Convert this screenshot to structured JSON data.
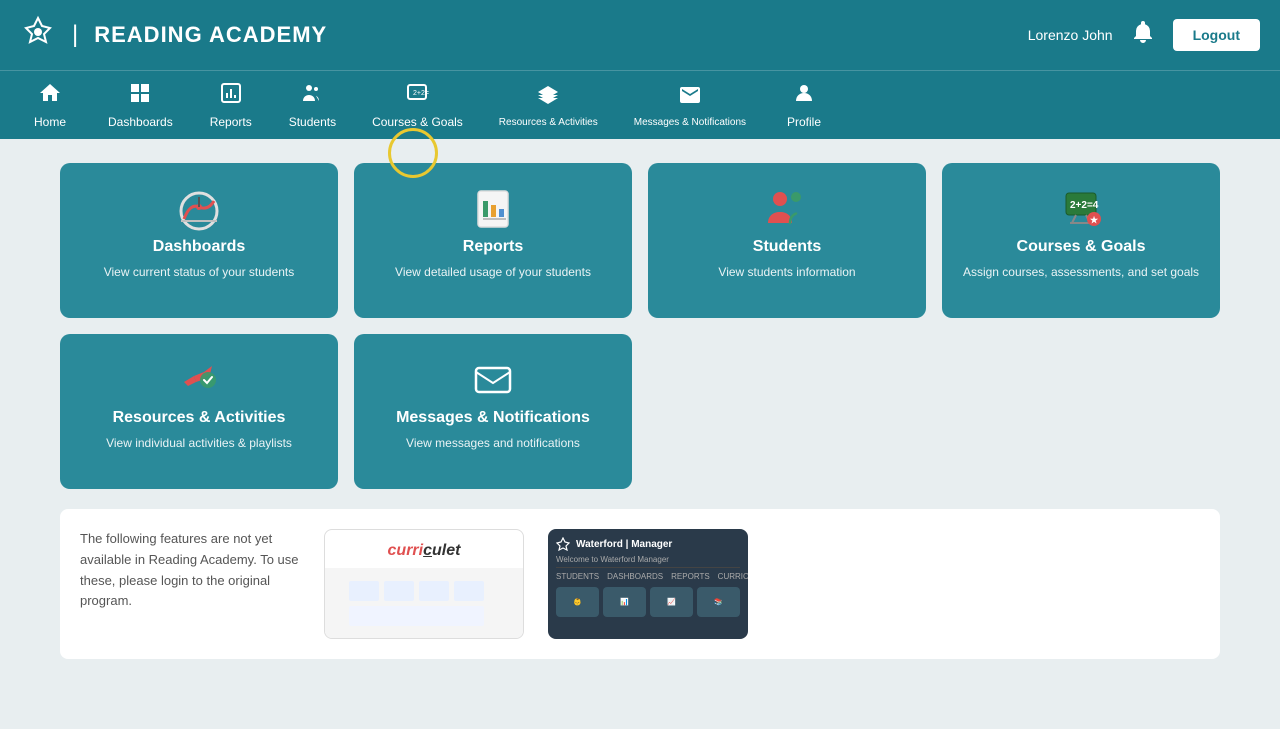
{
  "header": {
    "logo_text": "READING ACADEMY",
    "user_name": "Lorenzo John",
    "logout_label": "Logout"
  },
  "nav": {
    "items": [
      {
        "id": "home",
        "label": "Home",
        "icon": "home"
      },
      {
        "id": "dashboards",
        "label": "Dashboards",
        "icon": "dashboard"
      },
      {
        "id": "reports",
        "label": "Reports",
        "icon": "reports"
      },
      {
        "id": "students",
        "label": "Students",
        "icon": "students"
      },
      {
        "id": "courses",
        "label": "Courses & Goals",
        "icon": "courses"
      },
      {
        "id": "resources",
        "label": "Resources & Activities",
        "icon": "resources"
      },
      {
        "id": "messages",
        "label": "Messages & Notifications",
        "icon": "messages"
      },
      {
        "id": "profile",
        "label": "Profile",
        "icon": "profile"
      }
    ]
  },
  "cards": {
    "row1": [
      {
        "id": "dashboards",
        "title": "Dashboards",
        "desc": "View current status of your students"
      },
      {
        "id": "reports",
        "title": "Reports",
        "desc": "View detailed usage of your students"
      },
      {
        "id": "students",
        "title": "Students",
        "desc": "View students information"
      },
      {
        "id": "courses",
        "title": "Courses & Goals",
        "desc": "Assign courses, assessments, and set goals"
      }
    ],
    "row2": [
      {
        "id": "resources",
        "title": "Resources & Activities",
        "desc": "View individual activities & playlists"
      },
      {
        "id": "messages",
        "title": "Messages & Notifications",
        "desc": "View messages and notifications"
      }
    ]
  },
  "bottom": {
    "notice": "The following features are not yet available in Reading Academy. To use these, please login to the original program.",
    "preview1_label": "curriculet",
    "preview2_label": "Waterford | Manager"
  }
}
